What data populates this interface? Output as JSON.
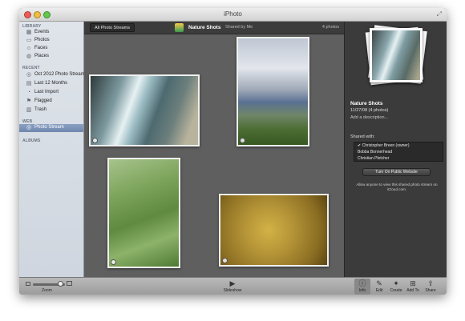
{
  "window": {
    "title": "iPhoto"
  },
  "sidebar": {
    "sections": {
      "library": "LIBRARY",
      "recent": "RECENT",
      "web": "WEB",
      "albums": "ALBUMS"
    },
    "library_items": [
      {
        "label": "Events",
        "icon": "events-icon"
      },
      {
        "label": "Photos",
        "icon": "photos-icon"
      },
      {
        "label": "Faces",
        "icon": "faces-icon"
      },
      {
        "label": "Places",
        "icon": "places-icon"
      }
    ],
    "recent_items": [
      {
        "label": "Oct 2012 Photo Stream",
        "icon": "photo-stream-icon"
      },
      {
        "label": "Last 12 Months",
        "icon": "calendar-icon"
      },
      {
        "label": "Last Import",
        "icon": "import-icon"
      },
      {
        "label": "Flagged",
        "icon": "flag-icon"
      },
      {
        "label": "Trash",
        "icon": "trash-icon"
      }
    ],
    "web_items": [
      {
        "label": "Photo Stream",
        "icon": "photo-stream-icon",
        "selected": true
      }
    ]
  },
  "topbar": {
    "back_button": "All Photo Streams",
    "album_title": "Nature Shots",
    "shared_by": "Shared by Me",
    "photo_count": "4 photos"
  },
  "photos": [
    {
      "subject": "waterfall"
    },
    {
      "subject": "mountains-sky"
    },
    {
      "subject": "cactus"
    },
    {
      "subject": "cactus-closeup"
    }
  ],
  "info_panel": {
    "title": "Nature Shots",
    "date": "11/27/08 (4 photos)",
    "description_placeholder": "Add a description...",
    "shared_with_label": "Shared with:",
    "shared_with": [
      {
        "name": "✔ Christopher Breen (owner)"
      },
      {
        "name": "Bobba Bonnerhead"
      },
      {
        "name": "Christian Pletcher"
      }
    ],
    "public_button": "Turn On Public Website",
    "note": "Allow anyone to view this shared photo stream on iCloud.com."
  },
  "bottombar": {
    "zoom_label": "Zoom",
    "slideshow_label": "Slideshow",
    "info_label": "Info",
    "edit_label": "Edit",
    "create_label": "Create",
    "add_to_label": "Add To",
    "share_label": "Share"
  },
  "colors": {
    "sidebar_selection": "#7a91b7",
    "canvas_background": "#5f5f5f",
    "info_background": "#3b3b3b"
  }
}
